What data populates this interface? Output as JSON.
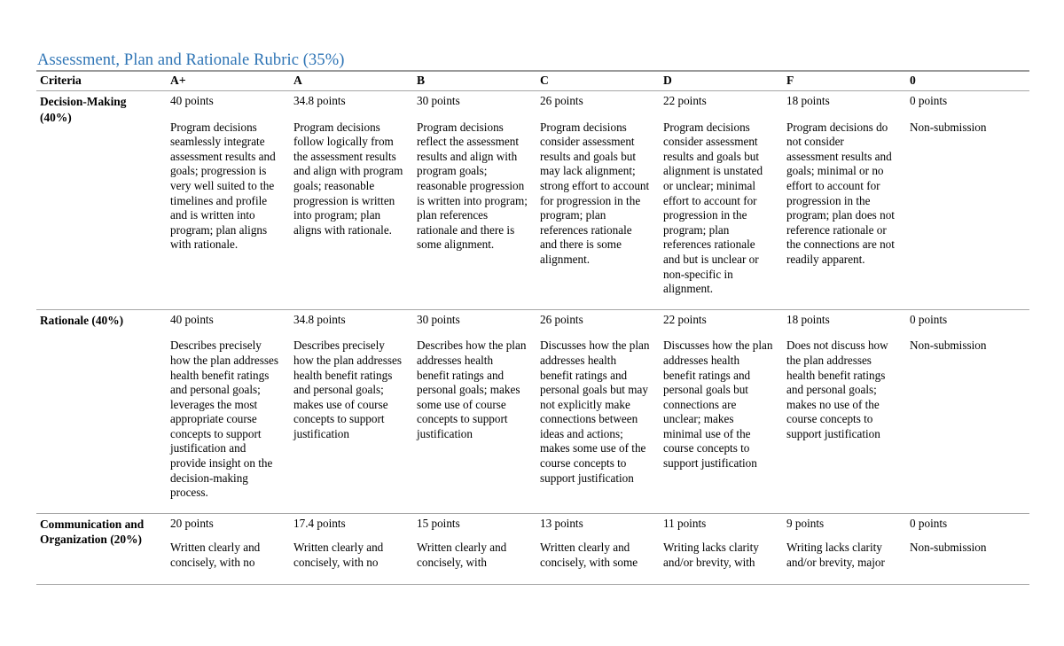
{
  "document": {
    "title": "Assessment, Plan and Rationale Rubric (35%)",
    "title_color": "#2e74b5"
  },
  "table": {
    "headers": [
      "Criteria",
      "A+",
      "A",
      "B",
      "C",
      "D",
      "F",
      "0"
    ],
    "rows": [
      {
        "criteria": "Decision-Making (40%)",
        "cells": [
          {
            "points": "40 points",
            "description": "Program decisions seamlessly integrate assessment results and goals; progression is very well suited to the timelines and profile and is written into program; plan aligns with rationale."
          },
          {
            "points": "34.8 points",
            "description": "Program decisions follow logically from the assessment results and align with program goals; reasonable progression is written into program; plan aligns with rationale."
          },
          {
            "points": "30 points",
            "description": "Program decisions reflect the assessment results and align with program goals; reasonable progression is written into program; plan references rationale and there is some alignment."
          },
          {
            "points": "26 points",
            "description": "Program decisions consider assessment results and goals but may lack alignment; strong effort to account for progression in the program; plan references rationale and there is some alignment."
          },
          {
            "points": "22 points",
            "description": "Program decisions consider assessment results and goals but alignment is unstated or unclear; minimal effort to account for progression in the program; plan references rationale and but is unclear or non-specific in alignment."
          },
          {
            "points": "18 points",
            "description": "Program decisions do not consider assessment results and goals; minimal or no effort to account for progression in the program; plan does not reference rationale or the connections are not readily apparent."
          },
          {
            "points": "0 points",
            "description": "Non-submission"
          }
        ]
      },
      {
        "criteria": "Rationale (40%)",
        "cells": [
          {
            "points": "40 points",
            "description": "Describes precisely how the plan addresses health benefit ratings and personal goals; leverages the most appropriate course concepts to support justification and provide insight on the decision-making process."
          },
          {
            "points": "34.8 points",
            "description": "Describes precisely how the plan addresses health benefit ratings and personal goals; makes use of course concepts to support justification"
          },
          {
            "points": "30 points",
            "description": "Describes how the plan addresses health benefit ratings and personal goals; makes some use of course concepts to support justification"
          },
          {
            "points": "26 points",
            "description": "Discusses how the plan addresses health benefit ratings and personal goals but may not explicitly make connections between ideas and actions; makes some use of the course concepts to support justification"
          },
          {
            "points": "22 points",
            "description": "Discusses how the plan addresses health benefit ratings and personal goals but connections are unclear; makes minimal use of the course concepts to support justification"
          },
          {
            "points": "18 points",
            "description": "Does not discuss how the plan addresses health benefit ratings and personal goals; makes no use of the course concepts to support justification"
          },
          {
            "points": "0 points",
            "description": "Non-submission"
          }
        ]
      },
      {
        "criteria": "Communication and Organization (20%)",
        "cells": [
          {
            "points": "20 points",
            "description": "Written clearly and concisely, with no major grammatical"
          },
          {
            "points": "17.4 points",
            "description": "Written clearly and concisely, with no major grammatical"
          },
          {
            "points": "15 points",
            "description": "Written clearly and concisely, with minimal major"
          },
          {
            "points": "13 points",
            "description": "Written clearly and concisely, with some major grammatical"
          },
          {
            "points": "11 points",
            "description": "Writing lacks clarity and/or brevity, with some major"
          },
          {
            "points": "9 points",
            "description": "Writing lacks clarity and/or brevity, major errors distract or"
          },
          {
            "points": "0 points",
            "description": "Non-submission"
          }
        ]
      }
    ]
  }
}
